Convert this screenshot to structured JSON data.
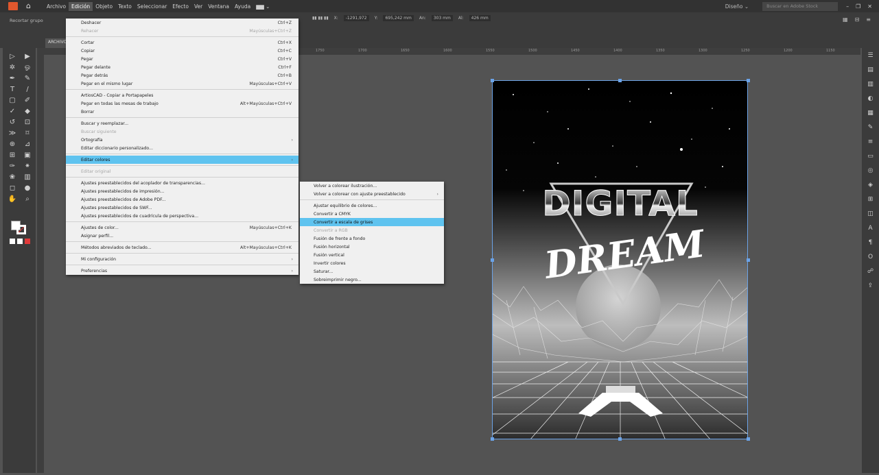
{
  "menubar": {
    "items": [
      "Archivo",
      "Edición",
      "Objeto",
      "Texto",
      "Seleccionar",
      "Efecto",
      "Ver",
      "Ventana",
      "Ayuda"
    ],
    "active_index": 1,
    "workspace": "Diseño",
    "search_placeholder": "Buscar en Adobe Stock"
  },
  "control_bar": {
    "label": "Recortar grupo",
    "x": "-1291,972",
    "y": "695,242 mm",
    "width": "303 mm",
    "height": "426 mm"
  },
  "document_tab": "ARCHIVO",
  "ruler_ticks": [
    "1750",
    "1700",
    "1650",
    "1600",
    "1550",
    "1500",
    "1450",
    "1400",
    "1350",
    "1300",
    "1250",
    "1200",
    "1150"
  ],
  "edit_menu": {
    "items": [
      {
        "label": "Deshacer",
        "shortcut": "Ctrl+Z"
      },
      {
        "label": "Rehacer",
        "shortcut": "Mayúsculas+Ctrl+Z",
        "disabled": true
      },
      {
        "sep": true
      },
      {
        "label": "Cortar",
        "shortcut": "Ctrl+X"
      },
      {
        "label": "Copiar",
        "shortcut": "Ctrl+C"
      },
      {
        "label": "Pegar",
        "shortcut": "Ctrl+V"
      },
      {
        "label": "Pegar delante",
        "shortcut": "Ctrl+F"
      },
      {
        "label": "Pegar detrás",
        "shortcut": "Ctrl+B"
      },
      {
        "label": "Pegar en el mismo lugar",
        "shortcut": "Mayúsculas+Ctrl+V"
      },
      {
        "sep": true
      },
      {
        "label": "ArtiosCAD - Copiar a Portapapeles"
      },
      {
        "label": "Pegar en todas las mesas de trabajo",
        "shortcut": "Alt+Mayúsculas+Ctrl+V"
      },
      {
        "label": "Borrar"
      },
      {
        "sep": true
      },
      {
        "label": "Buscar y reemplazar..."
      },
      {
        "label": "Buscar siguiente",
        "disabled": true
      },
      {
        "label": "Ortografía",
        "submenu": true
      },
      {
        "label": "Editar diccionario personalizado..."
      },
      {
        "sep": true
      },
      {
        "label": "Editar colores",
        "submenu": true,
        "highlighted": true
      },
      {
        "sep": true
      },
      {
        "label": "Editar original",
        "disabled": true
      },
      {
        "sep": true
      },
      {
        "label": "Ajustes preestablecidos del acoplador de transparencias..."
      },
      {
        "label": "Ajustes preestablecidos de impresión..."
      },
      {
        "label": "Ajustes preestablecidos de Adobe PDF..."
      },
      {
        "label": "Ajustes preestablecidos de SWF..."
      },
      {
        "label": "Ajustes preestablecidos de cuadrícula de perspectiva..."
      },
      {
        "sep": true
      },
      {
        "label": "Ajustes de color...",
        "shortcut": "Mayúsculas+Ctrl+K"
      },
      {
        "label": "Asignar perfil..."
      },
      {
        "sep": true
      },
      {
        "label": "Métodos abreviados de teclado...",
        "shortcut": "Alt+Mayúsculas+Ctrl+K"
      },
      {
        "sep": true
      },
      {
        "label": "Mi configuración",
        "submenu": true
      },
      {
        "sep": true
      },
      {
        "label": "Preferencias",
        "submenu": true
      }
    ]
  },
  "colors_submenu": {
    "items": [
      {
        "label": "Volver a colorear ilustración..."
      },
      {
        "label": "Volver a colorear con ajuste preestablecido",
        "submenu": true
      },
      {
        "sep": true
      },
      {
        "label": "Ajustar equilibrio de colores..."
      },
      {
        "label": "Convertir a CMYK"
      },
      {
        "label": "Convertir a escala de grises",
        "highlighted": true
      },
      {
        "label": "Convertir a RGB",
        "disabled": true
      },
      {
        "label": "Fusión de frente a fondo"
      },
      {
        "label": "Fusión horizontal"
      },
      {
        "label": "Fusión vertical"
      },
      {
        "label": "Invertir colores"
      },
      {
        "label": "Saturar..."
      },
      {
        "label": "Sobreimprimir negro..."
      }
    ]
  },
  "artwork": {
    "title_line1": "DIGITAL",
    "title_line2": "DREAM"
  },
  "colors": {
    "menu_highlight": "#5fc3ef",
    "selection": "#6ba3e8",
    "app_accent": "#e0572d"
  }
}
